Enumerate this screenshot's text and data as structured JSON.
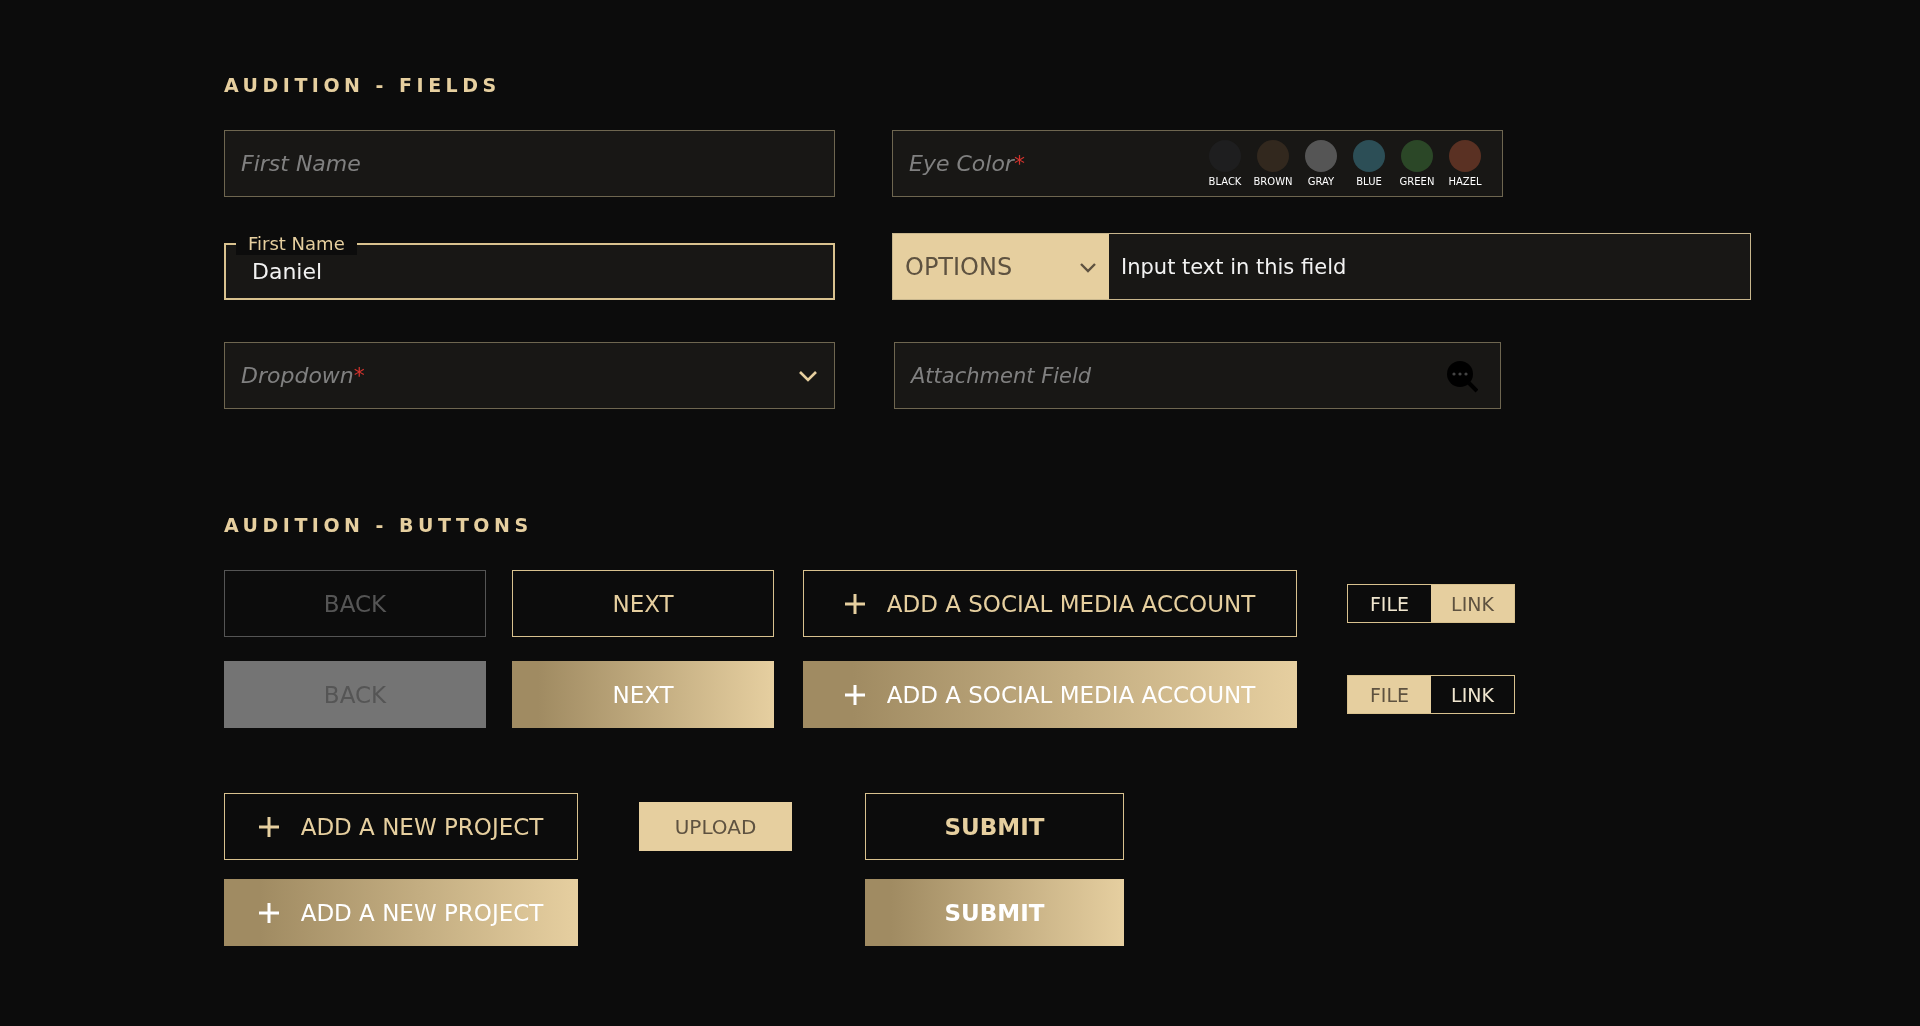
{
  "field_section": {
    "title": "AUDITION - FIELDS",
    "rows": [
      {
        "items": [
          {
            "kind": "text",
            "placeholder": "First Name"
          },
          {
            "kind": "color-picker",
            "label": "Eye Color",
            "required_mark": "*",
            "swatches": [
              {
                "label": "BLACK",
                "color": "#1e1e1f"
              },
              {
                "label": "BROWN",
                "color": "#32281e"
              },
              {
                "label": "GRAY",
                "color": "#555555"
              },
              {
                "label": "BLUE",
                "color": "#2c4e56"
              },
              {
                "label": "GREEN",
                "color": "#2b4727"
              },
              {
                "label": "HAZEL",
                "color": "#5a3123"
              }
            ]
          }
        ]
      },
      {
        "items": [
          {
            "kind": "outlined",
            "label": "First Name",
            "value": "Daniel"
          },
          {
            "kind": "combo",
            "option_label": "OPTIONS",
            "value": "Input text in this field"
          }
        ]
      },
      {
        "items": [
          {
            "kind": "dropdown",
            "placeholder": "Dropdown",
            "required_mark": "*"
          },
          {
            "kind": "attachment",
            "placeholder": "Attachment Field"
          }
        ]
      }
    ]
  },
  "button_section": {
    "title": "AUDITION - BUTTONS",
    "rows": [
      {
        "kind": "outline",
        "items": [
          {
            "kind": "button",
            "label": "BACK",
            "disabled": true
          },
          {
            "kind": "button",
            "label": "NEXT",
            "disabled": false
          },
          {
            "kind": "add",
            "label": "ADD A SOCIAL MEDIA ACCOUNT",
            "disabled": false
          },
          {
            "kind": "toggle",
            "options": [
              {
                "label": "FILE",
                "selected": false
              },
              {
                "label": "LINK",
                "selected": true
              }
            ]
          }
        ]
      },
      {
        "kind": "filled",
        "items": [
          {
            "kind": "button",
            "label": "BACK",
            "disabled": true
          },
          {
            "kind": "button",
            "label": "NEXT",
            "disabled": false
          },
          {
            "kind": "add",
            "label": "ADD A SOCIAL MEDIA ACCOUNT",
            "disabled": false
          },
          {
            "kind": "toggle",
            "options": [
              {
                "label": "FILE",
                "selected": true
              },
              {
                "label": "LINK",
                "selected": false
              }
            ]
          }
        ]
      },
      {
        "kind": "outline",
        "items": [
          {
            "kind": "add",
            "label": "ADD A NEW PROJECT",
            "disabled": false
          },
          {
            "kind": "upload",
            "label": "UPLOAD",
            "disabled": false
          },
          {
            "kind": "submit",
            "label": "SUBMIT",
            "disabled": false
          }
        ]
      },
      {
        "kind": "filled",
        "items": [
          {
            "kind": "add",
            "label": "ADD A NEW PROJECT",
            "disabled": false
          },
          {
            "kind": "submit",
            "label": "SUBMIT",
            "disabled": false
          }
        ]
      }
    ]
  }
}
